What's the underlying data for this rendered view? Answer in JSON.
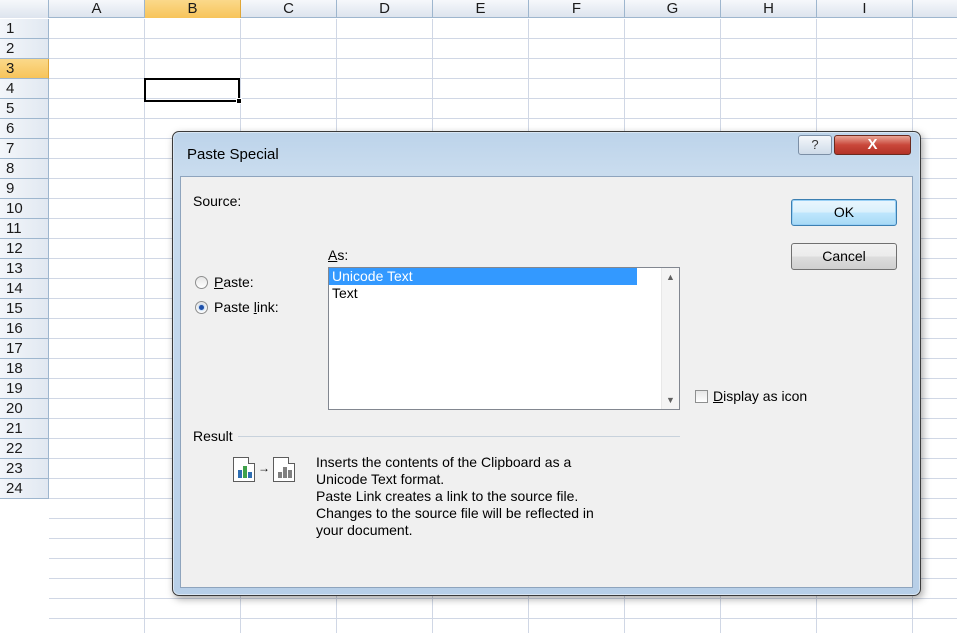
{
  "sheet": {
    "columns": [
      "A",
      "B",
      "C",
      "D",
      "E",
      "F",
      "G",
      "H",
      "I"
    ],
    "selected_column": "B",
    "rows": [
      "1",
      "2",
      "3",
      "4",
      "5",
      "6",
      "7",
      "8",
      "9",
      "10",
      "11",
      "12",
      "13",
      "14",
      "15",
      "16",
      "17",
      "18",
      "19",
      "20",
      "21",
      "22",
      "23",
      "24"
    ],
    "selected_row": "3"
  },
  "dialog": {
    "title": "Paste Special",
    "help_label": "?",
    "close_label": "X",
    "source_label": "Source:",
    "as_label_prefix": "",
    "as_label_u": "A",
    "as_label_rest": "s:",
    "paste_option": {
      "u": "P",
      "rest": "aste:",
      "checked": false
    },
    "paste_link_option": {
      "pre": "Paste ",
      "u": "l",
      "rest": "ink:",
      "checked": true
    },
    "list_items": [
      "Unicode Text",
      "Text"
    ],
    "selected_item": "Unicode Text",
    "ok_label": "OK",
    "cancel_label": "Cancel",
    "display_as_icon": {
      "u": "D",
      "rest": "isplay as icon",
      "checked": false
    },
    "result_label": "Result",
    "result_description": [
      "Inserts the contents of the Clipboard as a",
      "Unicode Text format.",
      "Paste Link creates a link to the source file.",
      "Changes to the source file will be reflected in",
      "your document."
    ],
    "colors": {
      "selection": "#3399ff",
      "title_bar": "#c9dcee",
      "close_button": "#c9473a"
    }
  }
}
